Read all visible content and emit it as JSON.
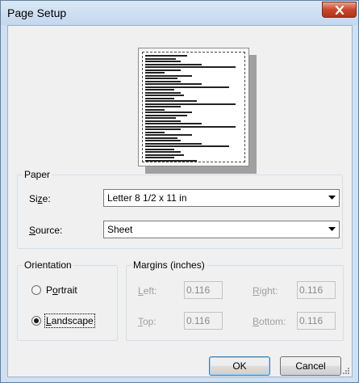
{
  "window": {
    "title": "Page Setup"
  },
  "preview": {
    "lines": 38
  },
  "paper": {
    "group_label": "Paper",
    "size_label": "Size:",
    "size_label_pre": "Si",
    "size_label_mnemonic": "z",
    "size_label_post": "e:",
    "size_value": "Letter 8 1/2 x 11 in",
    "source_label": "Source:",
    "source_label_mnemonic": "S",
    "source_label_post": "ource:",
    "source_value": "Sheet"
  },
  "orientation": {
    "group_label": "Orientation",
    "portrait_label": "Portrait",
    "portrait_pre": "P",
    "portrait_mnemonic": "o",
    "portrait_post": "rtrait",
    "landscape_label": "Landscape",
    "landscape_mnemonic": "L",
    "landscape_post": "andscape",
    "selected": "Landscape"
  },
  "margins": {
    "group_label": "Margins (inches)",
    "left_mnemonic": "L",
    "left_post": "eft:",
    "right_mnemonic": "R",
    "right_post": "ight:",
    "top_mnemonic": "T",
    "top_post": "op:",
    "bottom_mnemonic": "B",
    "bottom_post": "ottom:",
    "left_value": "0.116",
    "right_value": "0.116",
    "top_value": "0.116",
    "bottom_value": "0.116"
  },
  "buttons": {
    "ok": "OK",
    "cancel": "Cancel"
  }
}
